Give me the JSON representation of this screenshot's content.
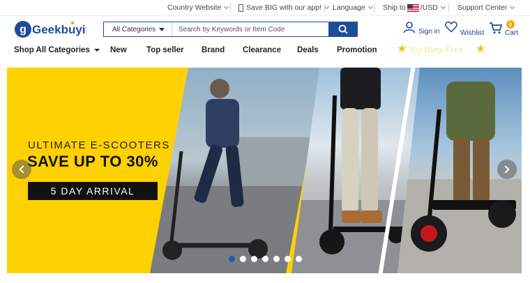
{
  "topbar": {
    "country": "Country Website",
    "app": "Save BIG with our app!",
    "language": "Language",
    "ship_to": "Ship to",
    "currency": "/USD",
    "support": "Support Center"
  },
  "header": {
    "logo": "Geekbuying",
    "search_category": "All Categories",
    "search_placeholder": "Search by Keywords or Item Code",
    "signin": "Sign in",
    "wishlist": "Wishlist",
    "cart": "Cart",
    "cart_count": "0"
  },
  "nav": {
    "items": [
      "Shop All Categories",
      "New",
      "Top seller",
      "Brand",
      "Clearance",
      "Deals",
      "Promotion"
    ],
    "promo": "EU Duty Free"
  },
  "banner": {
    "headline": "ULTIMATE E-SCOOTERS",
    "offer": "SAVE UP TO 30%",
    "badge": "5 DAY ARRIVAL",
    "slides": 7,
    "active_slide": 1
  },
  "colors": {
    "brand_blue": "#1e4c9a",
    "banner_yellow": "#ffd100",
    "star": "#f4c21b",
    "cart_badge": "#f7a600"
  }
}
